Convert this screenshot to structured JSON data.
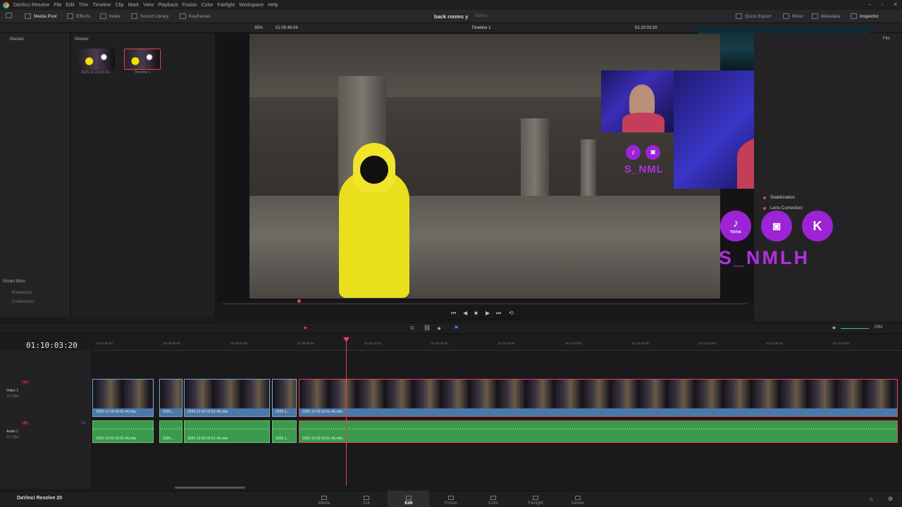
{
  "app": {
    "title": "DaVinci Resolve",
    "footer_brand": "DaVinci Resolve 20"
  },
  "menu": [
    "File",
    "Edit",
    "Trim",
    "Timeline",
    "Clip",
    "Mark",
    "View",
    "Playback",
    "Fusion",
    "Color",
    "Fairlight",
    "Workspace",
    "Help"
  ],
  "toolbar": {
    "media_pool": "Media Pool",
    "effects": "Effects",
    "index": "Index",
    "sound_library": "Sound Library",
    "keyframes": "Keyframes",
    "quick_export": "Quick Export",
    "mixer": "Mixer",
    "metadata": "Metadata",
    "inspector": "Inspector"
  },
  "project": {
    "name": "back rooms y",
    "status": "Edited"
  },
  "viewer": {
    "zoom": "35%",
    "source_tc": "01:09:46:06",
    "timeline_name": "Timeline 1",
    "timecode": "01:10:03:20"
  },
  "panels": {
    "master_left": "Master",
    "master_media": "Master",
    "smart_bins": "Smart Bins",
    "keywords": "Keywords",
    "collections": "Collections",
    "file_tab": "File"
  },
  "media_items": [
    {
      "label": "2025-12-03 03-51..."
    },
    {
      "label": "Timeline 1"
    }
  ],
  "inspector_rows": [
    {
      "label": "Stabilization"
    },
    {
      "label": "Lens Correction"
    }
  ],
  "overlay": {
    "brand_small": "S_NML",
    "brand_large": "S_NMLH",
    "tiktok": "TikTok"
  },
  "timeline": {
    "timecode": "01:10:03:20",
    "ruler": [
      "01:07:56:00",
      "01:08:30:00",
      "01:09:04:00",
      "01:09:38:00",
      "01:10:12:00",
      "01:10:46:00",
      "01:11:20:00",
      "01:11:54:00",
      "01:12:28:00",
      "01:13:02:00",
      "01:13:36:00",
      "01:14:10:00"
    ],
    "dim_label": "DIM",
    "video_track": {
      "badge": "V1",
      "name": "Video 1",
      "clips": "15 Clips"
    },
    "audio_track": {
      "badge": "A1",
      "name": "Audio 1",
      "clips": "15 Clips",
      "level": "2.0"
    },
    "clip_label": "2025-12-03 03-51-46.mkv",
    "clip_short": "2025-...",
    "clip_short2": "2025-1..."
  },
  "pages": [
    "Media",
    "Cut",
    "Edit",
    "Fusion",
    "Color",
    "Fairlight",
    "Deliver"
  ],
  "active_page": "Edit"
}
